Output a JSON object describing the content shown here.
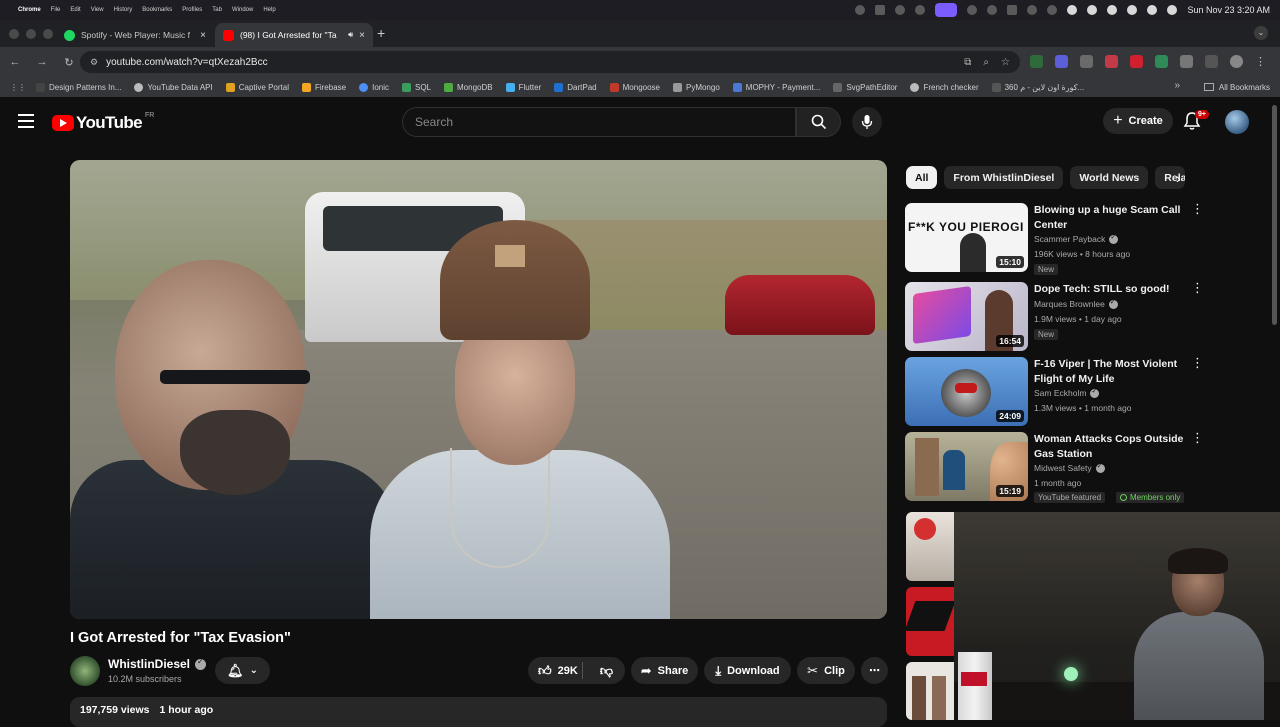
{
  "menubar": {
    "app": "Chrome",
    "items": [
      "File",
      "Edit",
      "View",
      "History",
      "Bookmarks",
      "Profiles",
      "Tab",
      "Window",
      "Help"
    ],
    "clock": "Sun Nov 23  3:20 AM"
  },
  "tabs": [
    {
      "title": "Spotify - Web Player: Music f",
      "close": "×"
    },
    {
      "title": "(98) I Got Arrested for \"Ta",
      "close": "×"
    }
  ],
  "toolbar": {
    "url": "youtube.com/watch?v=qtXezah2Bcc"
  },
  "bookmarks": {
    "items": [
      "Design Patterns In...",
      "YouTube Data API",
      "Captive Portal",
      "Firebase",
      "Ionic",
      "SQL",
      "MongoDB",
      "Flutter",
      "DartPad",
      "Mongoose",
      "PyMongo",
      "MOPHY - Payment...",
      "SvgPathEditor",
      "French checker",
      "360 كورة اون لاين - م..."
    ],
    "all": "All Bookmarks"
  },
  "header": {
    "logo": "YouTube",
    "country": "FR",
    "search_placeholder": "Search",
    "create": "Create",
    "notifications": "9+"
  },
  "video": {
    "title": "I Got Arrested for \"Tax Evasion\"",
    "channel": "WhistlinDiesel",
    "subscribers": "10.2M subscribers",
    "likes": "29K",
    "share": "Share",
    "download": "Download",
    "clip": "Clip",
    "views": "197,759 views",
    "age": "1 hour ago"
  },
  "chips": [
    "All",
    "From WhistlinDiesel",
    "World News",
    "Rela"
  ],
  "recommendations": [
    {
      "title": "Blowing up a huge Scam Call Center",
      "channel": "Scammer Payback",
      "meta": "196K views • 8 hours ago",
      "duration": "15:10",
      "badge": "New",
      "thumb_text": "F**K YOU PIEROGI"
    },
    {
      "title": "Dope Tech: STILL so good!",
      "channel": "Marques Brownlee",
      "meta": "1.9M views • 1 day ago",
      "duration": "16:54",
      "badge": "New"
    },
    {
      "title": "F-16 Viper | The Most Violent Flight of My Life",
      "channel": "Sam Eckholm",
      "meta": "1.3M views • 1 month ago",
      "duration": "24:09"
    },
    {
      "title": "Woman Attacks Cops Outside Gas Station",
      "channel": "Midwest Safety",
      "meta": "1 month ago",
      "duration": "15:19",
      "badge": "YouTube featured",
      "badge2": "Members only"
    }
  ],
  "colors": {
    "youtube_red": "#ff0000",
    "background": "#0f0f0f",
    "chip": "#272727"
  }
}
